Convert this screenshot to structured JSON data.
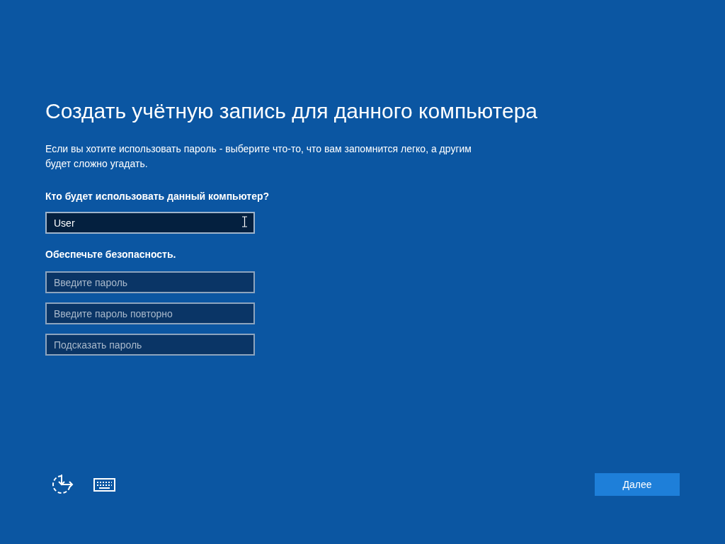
{
  "title": "Создать учётную запись для данного компьютера",
  "description": "Если вы хотите использовать пароль - выберите что-то, что вам запомнится легко, а другим будет сложно угадать.",
  "user_section": {
    "label": "Кто будет использовать данный компьютер?",
    "field": {
      "value": "User",
      "focused": true
    }
  },
  "security_section": {
    "label": "Обеспечьте безопасность.",
    "fields": [
      {
        "placeholder": "Введите пароль"
      },
      {
        "placeholder": "Введите пароль повторно"
      },
      {
        "placeholder": "Подсказать пароль"
      }
    ]
  },
  "next_button": "Далее"
}
